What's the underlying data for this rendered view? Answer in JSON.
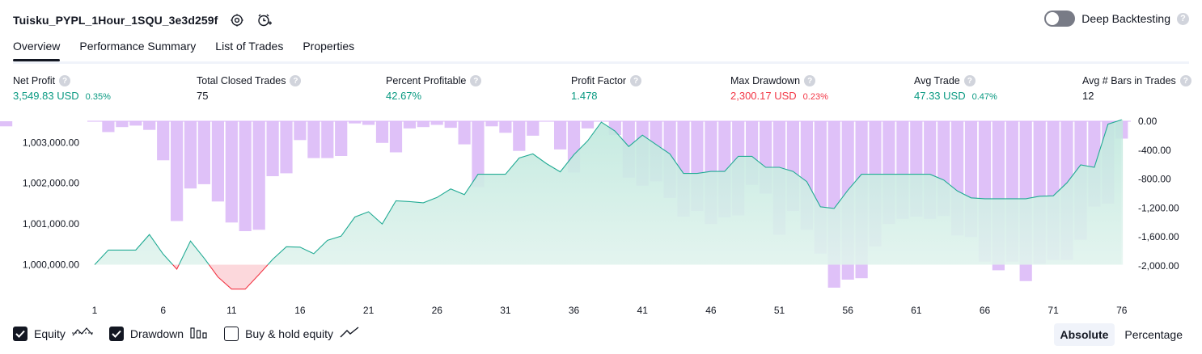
{
  "header": {
    "title": "Tuisku_PYPL_1Hour_1SQU_3e3d259f",
    "deep_backtesting": "Deep Backtesting"
  },
  "tabs": [
    "Overview",
    "Performance Summary",
    "List of Trades",
    "Properties"
  ],
  "metrics": [
    {
      "label": "Net Profit",
      "value": "3,549.83 USD",
      "pct": "0.35%",
      "color": "green"
    },
    {
      "label": "Total Closed Trades",
      "value": "75",
      "pct": "",
      "color": "dark"
    },
    {
      "label": "Percent Profitable",
      "value": "42.67%",
      "pct": "",
      "color": "green"
    },
    {
      "label": "Profit Factor",
      "value": "1.478",
      "pct": "",
      "color": "green"
    },
    {
      "label": "Max Drawdown",
      "value": "2,300.17 USD",
      "pct": "0.23%",
      "color": "red"
    },
    {
      "label": "Avg Trade",
      "value": "47.33 USD",
      "pct": "0.47%",
      "color": "green"
    },
    {
      "label": "Avg # Bars in Trades",
      "value": "12",
      "pct": "",
      "color": "dark"
    }
  ],
  "legend": {
    "equity": "Equity",
    "drawdown": "Drawdown",
    "buy_hold": "Buy & hold equity"
  },
  "modes": {
    "absolute": "Absolute",
    "percentage": "Percentage"
  },
  "colors": {
    "equity_line": "#22ab94",
    "equity_fill": "#cfeee6",
    "negative": "#f23645",
    "drawdown": "#d9b6f7",
    "text_green": "#089981",
    "text_red": "#f23645"
  },
  "chart_data": {
    "type": "area",
    "x_ticks": [
      1,
      6,
      11,
      16,
      21,
      26,
      31,
      36,
      41,
      46,
      51,
      56,
      61,
      66,
      71,
      76
    ],
    "left_axis_ticks": [
      "1,000,000.00",
      "1,001,000.00",
      "1,002,000.00",
      "1,003,000.00"
    ],
    "left_axis_values": [
      1000000,
      1001000,
      1002000,
      1003000
    ],
    "right_axis_ticks": [
      "0.00",
      "-400.00",
      "-800.00",
      "-1,200.00",
      "-1,600.00",
      "-2,000.00"
    ],
    "right_axis_values": [
      0,
      -400,
      -800,
      -1200,
      -1600,
      -2000
    ],
    "baseline": 1000000,
    "equity": {
      "name": "Equity",
      "x": [
        1,
        2,
        3,
        4,
        5,
        6,
        7,
        8,
        9,
        10,
        11,
        12,
        13,
        14,
        15,
        16,
        17,
        18,
        19,
        20,
        21,
        22,
        23,
        24,
        25,
        26,
        27,
        28,
        29,
        30,
        31,
        32,
        33,
        34,
        35,
        36,
        37,
        38,
        39,
        40,
        41,
        42,
        43,
        44,
        45,
        46,
        47,
        48,
        49,
        50,
        51,
        52,
        53,
        54,
        55,
        56,
        57,
        58,
        59,
        60,
        61,
        62,
        63,
        64,
        65,
        66,
        67,
        68,
        69,
        70,
        71,
        72,
        73,
        74,
        75,
        76
      ],
      "y": [
        1000000,
        1000360,
        1000360,
        1000360,
        1000740,
        1000260,
        999890,
        1000580,
        1000160,
        999700,
        999400,
        999400,
        999760,
        1000130,
        1000440,
        1000430,
        1000270,
        1000600,
        1000700,
        1001170,
        1001300,
        1001000,
        1001570,
        1001550,
        1001520,
        1001650,
        1001860,
        1001720,
        1002220,
        1002220,
        1002220,
        1002620,
        1002720,
        1002480,
        1002280,
        1002700,
        1003040,
        1003500,
        1003280,
        1002900,
        1003180,
        1002950,
        1002720,
        1002240,
        1002240,
        1002290,
        1002290,
        1002660,
        1002660,
        1002390,
        1002390,
        1002290,
        1002040,
        1001420,
        1001380,
        1001830,
        1002220,
        1002220,
        1002220,
        1002220,
        1002220,
        1002220,
        1002080,
        1001810,
        1001640,
        1001620,
        1001620,
        1001620,
        1001620,
        1001680,
        1001690,
        1002010,
        1002450,
        1002390,
        1003450,
        1003560
      ]
    },
    "drawdown": {
      "name": "Drawdown",
      "x": [
        1,
        2,
        3,
        4,
        5,
        6,
        7,
        8,
        9,
        10,
        11,
        12,
        13,
        14,
        15,
        16,
        17,
        18,
        19,
        20,
        21,
        22,
        23,
        24,
        25,
        26,
        27,
        28,
        29,
        30,
        31,
        32,
        33,
        34,
        35,
        36,
        37,
        38,
        39,
        40,
        41,
        42,
        43,
        44,
        45,
        46,
        47,
        48,
        49,
        50,
        51,
        52,
        53,
        54,
        55,
        56,
        57,
        58,
        59,
        60,
        61,
        62,
        63,
        64,
        65,
        66,
        67,
        68,
        69,
        70,
        71,
        72,
        73,
        74,
        75,
        76
      ],
      "y": [
        0,
        -150,
        -80,
        -60,
        -120,
        -540,
        -1380,
        -930,
        -870,
        -1110,
        -1400,
        -1520,
        -1500,
        -760,
        -720,
        -260,
        -510,
        -510,
        -480,
        -30,
        -50,
        -300,
        -430,
        -100,
        -80,
        -50,
        -90,
        -320,
        -910,
        -70,
        -160,
        -410,
        -200,
        0,
        -390,
        -710,
        -100,
        0,
        -190,
        -780,
        -890,
        -830,
        -1060,
        -1320,
        -1240,
        -1420,
        -1330,
        -1300,
        -880,
        -1000,
        -1570,
        -1240,
        -1500,
        -1830,
        -2300,
        -2190,
        -2170,
        -1730,
        -1420,
        -1350,
        -1320,
        -1350,
        -1310,
        -1580,
        -1600,
        -1940,
        -2060,
        -1940,
        -2210,
        -1970,
        -1920,
        -1920,
        -1640,
        -1180,
        -1140,
        -240,
        -70
      ]
    }
  }
}
